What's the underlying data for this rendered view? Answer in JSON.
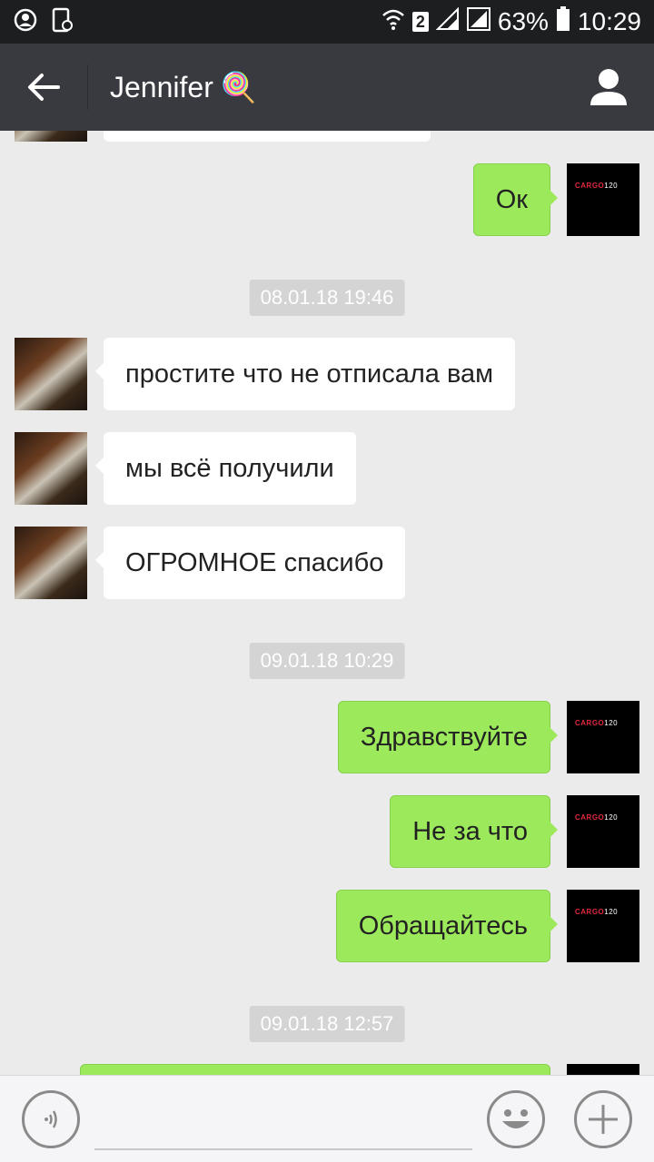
{
  "status_bar": {
    "sim_badge": "2",
    "battery_percent": "63%",
    "time": "10:29"
  },
  "header": {
    "title": "Jennifer",
    "title_emoji": "🍭"
  },
  "avatar_logo": {
    "brand": "CARGO",
    "number": "120"
  },
  "messages": [
    {
      "type": "out",
      "text": "Ок"
    },
    {
      "type": "timestamp",
      "text": "08.01.18 19:46"
    },
    {
      "type": "in",
      "text": "простите что не отписала вам"
    },
    {
      "type": "in",
      "text": "мы всё получили"
    },
    {
      "type": "in",
      "text": "ОГРОМНОЕ спасибо"
    },
    {
      "type": "timestamp",
      "text": "09.01.18 10:29"
    },
    {
      "type": "out",
      "text": "Здравствуйте"
    },
    {
      "type": "out",
      "text": "Не за что"
    },
    {
      "type": "out",
      "text": "Обращайтесь"
    },
    {
      "type": "timestamp",
      "text": "09.01.18 12:57"
    }
  ],
  "colors": {
    "header_bg": "#393a3f",
    "chat_bg": "#ebebeb",
    "outgoing_bubble": "#9de95c",
    "incoming_bubble": "#ffffff"
  }
}
